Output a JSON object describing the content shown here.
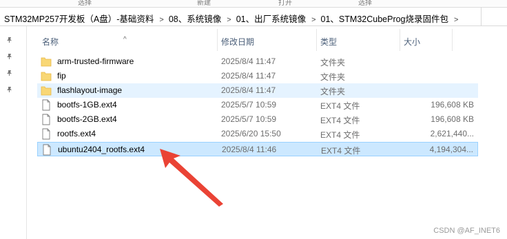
{
  "ribbon": {
    "labels": [
      "选择",
      "新建",
      "打开",
      "选择"
    ]
  },
  "breadcrumb": [
    "STM32MP257开发板（A盘）-基础资料",
    "08、系统镜像",
    "01、出厂系统镜像",
    "01、STM32CubeProg烧录固件包"
  ],
  "columns": {
    "name": "名称",
    "date": "修改日期",
    "type": "类型",
    "size": "大小"
  },
  "files": [
    {
      "name": "arm-trusted-firmware",
      "date": "2025/8/4 11:47",
      "type": "文件夹",
      "size": "",
      "icon": "folder-icon",
      "state": "normal"
    },
    {
      "name": "fip",
      "date": "2025/8/4 11:47",
      "type": "文件夹",
      "size": "",
      "icon": "folder-icon",
      "state": "normal"
    },
    {
      "name": "flashlayout-image",
      "date": "2025/8/4 11:47",
      "type": "文件夹",
      "size": "",
      "icon": "folder-icon",
      "state": "hover"
    },
    {
      "name": "bootfs-1GB.ext4",
      "date": "2025/5/7 10:59",
      "type": "EXT4 文件",
      "size": "196,608 KB",
      "icon": "file-icon",
      "state": "normal"
    },
    {
      "name": "bootfs-2GB.ext4",
      "date": "2025/5/7 10:59",
      "type": "EXT4 文件",
      "size": "196,608 KB",
      "icon": "file-icon",
      "state": "normal"
    },
    {
      "name": "rootfs.ext4",
      "date": "2025/6/20 15:50",
      "type": "EXT4 文件",
      "size": "2,621,440...",
      "icon": "file-icon",
      "state": "normal"
    },
    {
      "name": "ubuntu2404_rootfs.ext4",
      "date": "2025/8/4 11:46",
      "type": "EXT4 文件",
      "size": "4,194,304...",
      "icon": "file-icon",
      "state": "selected"
    }
  ],
  "watermark": "CSDN @AF_INET6",
  "colors": {
    "folder": "#f8d775",
    "folder_dark": "#e8b844",
    "selected_bg": "#cce8ff",
    "hover_bg": "#e5f3ff",
    "arrow": "#ea4335"
  }
}
